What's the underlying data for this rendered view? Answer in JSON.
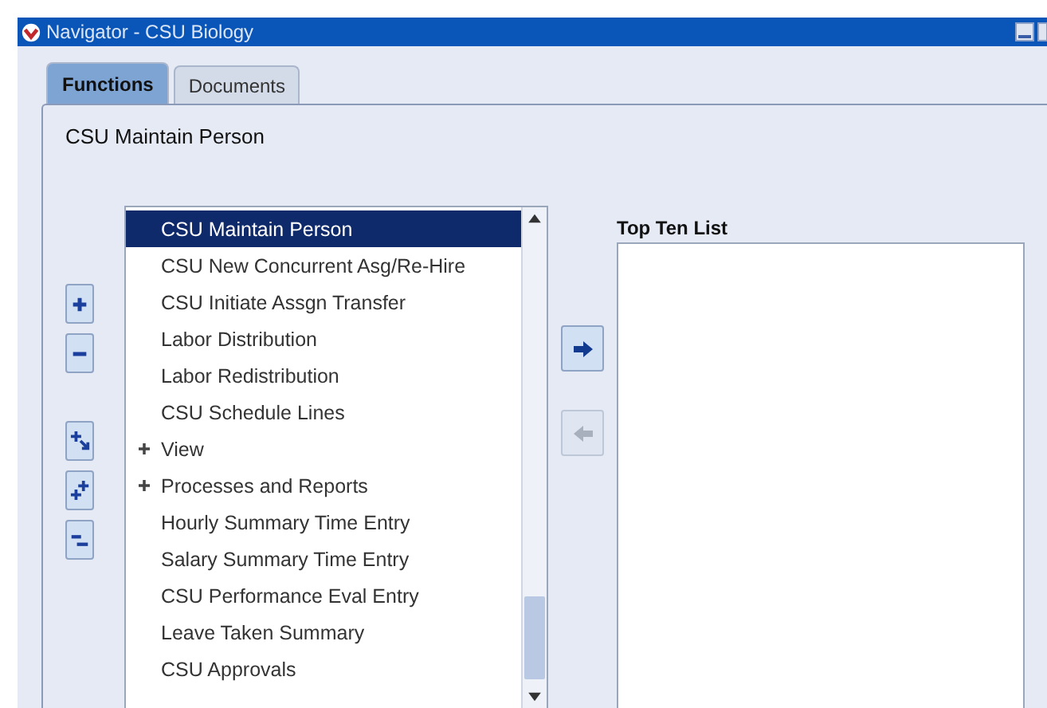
{
  "window": {
    "title": "Navigator - CSU Biology"
  },
  "tabs": [
    {
      "label": "Functions",
      "selected": true
    },
    {
      "label": "Documents",
      "selected": false
    }
  ],
  "current_function": "CSU Maintain Person",
  "functions": [
    {
      "label": "CSU Maintain Person",
      "kind": "function",
      "selected": true
    },
    {
      "label": "CSU New Concurrent Asg/Re-Hire",
      "kind": "function",
      "selected": false
    },
    {
      "label": "CSU Initiate Assgn Transfer",
      "kind": "function",
      "selected": false
    },
    {
      "label": "Labor Distribution",
      "kind": "function",
      "selected": false
    },
    {
      "label": "Labor Redistribution",
      "kind": "function",
      "selected": false
    },
    {
      "label": "CSU Schedule Lines",
      "kind": "function",
      "selected": false
    },
    {
      "label": "View",
      "kind": "group",
      "expanded": false,
      "selected": false
    },
    {
      "label": "Processes and Reports",
      "kind": "group",
      "expanded": false,
      "selected": false
    },
    {
      "label": "Hourly Summary Time Entry",
      "kind": "function",
      "selected": false
    },
    {
      "label": "Salary Summary Time Entry",
      "kind": "function",
      "selected": false
    },
    {
      "label": "CSU Performance Eval Entry",
      "kind": "function",
      "selected": false
    },
    {
      "label": "Leave Taken Summary",
      "kind": "function",
      "selected": false
    },
    {
      "label": "CSU Approvals",
      "kind": "function",
      "selected": false
    }
  ],
  "transfer_buttons": [
    {
      "kind": "add",
      "disabled": false
    },
    {
      "kind": "remove",
      "disabled": true
    }
  ],
  "top_ten": {
    "label": "Top Ten List"
  }
}
